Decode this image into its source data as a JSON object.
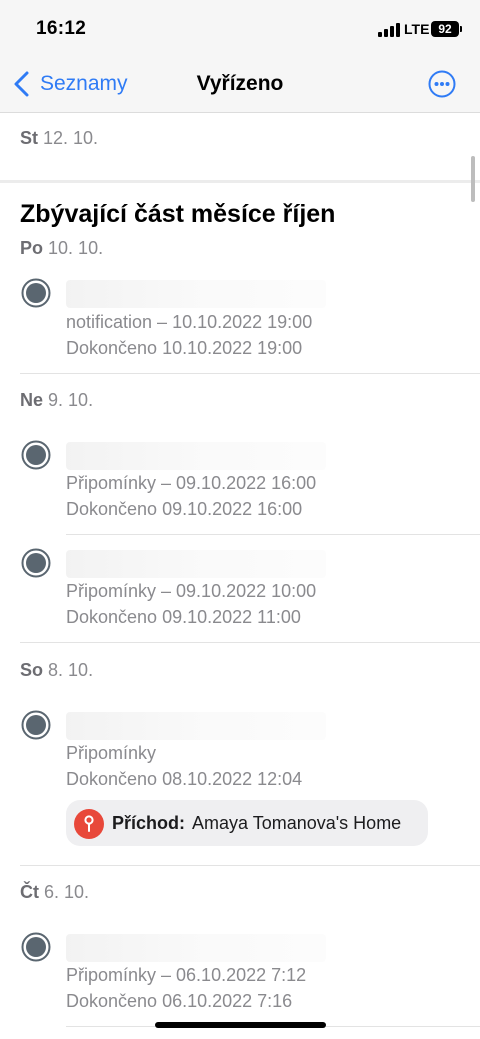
{
  "status_bar": {
    "time": "16:12",
    "network": "LTE",
    "battery": "92"
  },
  "nav": {
    "back_label": "Seznamy",
    "title": "Vyřízeno",
    "more_icon": "ellipsis-circle-icon"
  },
  "first_section": {
    "day": "St",
    "date": "12. 10."
  },
  "month_title": "Zbývající část měsíce říjen",
  "groups": [
    {
      "day": "Po",
      "date": "10. 10.",
      "items": [
        {
          "meta": "notification – 10.10.2022 19:00",
          "completed": "Dokončeno 10.10.2022 19:00"
        }
      ]
    },
    {
      "day": "Ne",
      "date": "9. 10.",
      "items": [
        {
          "meta": "Připomínky – 09.10.2022 16:00",
          "completed": "Dokončeno 09.10.2022 16:00"
        },
        {
          "meta": "Připomínky – 09.10.2022 10:00",
          "completed": "Dokončeno 09.10.2022 11:00"
        }
      ]
    },
    {
      "day": "So",
      "date": "8. 10.",
      "items": [
        {
          "meta": "Připomínky",
          "completed": "Dokončeno 08.10.2022 12:04",
          "location": {
            "label": "Příchod:",
            "name": "Amaya Tomanova's Home",
            "color": "#e8483a"
          }
        }
      ]
    },
    {
      "day": "Čt",
      "date": "6. 10.",
      "items": [
        {
          "meta": "Připomínky – 06.10.2022 7:12",
          "completed": "Dokončeno 06.10.2022 7:16"
        }
      ]
    }
  ],
  "colors": {
    "accent": "#2f7bf5",
    "checkbox": "#5a6670"
  }
}
